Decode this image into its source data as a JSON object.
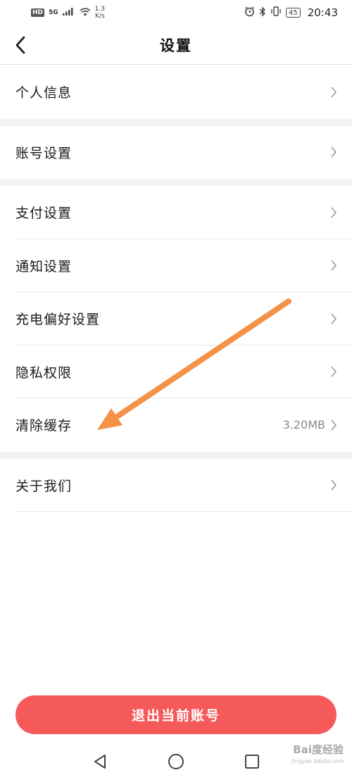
{
  "status_bar": {
    "hd": "HD",
    "signal_tech": "5G",
    "net_speed_value": "1.3",
    "net_speed_unit": "K/s",
    "battery": "45",
    "time": "20:43"
  },
  "header": {
    "title": "设置"
  },
  "settings": [
    {
      "label": "个人信息",
      "value": ""
    },
    {
      "label": "账号设置",
      "value": ""
    },
    {
      "label": "支付设置",
      "value": ""
    },
    {
      "label": "通知设置",
      "value": ""
    },
    {
      "label": "充电偏好设置",
      "value": ""
    },
    {
      "label": "隐私权限",
      "value": ""
    },
    {
      "label": "清除缓存",
      "value": "3.20MB"
    },
    {
      "label": "关于我们",
      "value": ""
    }
  ],
  "logout_label": "退出当前账号",
  "watermark": {
    "brand": "Bai度经验",
    "url": "jingyan.baidu.com"
  },
  "colors": {
    "logout_button": "#f45a5a",
    "annotation_arrow": "#f39248",
    "divider": "#e8e8e8",
    "group_gap": "#f3f3f3"
  },
  "icons": {
    "back": "chevron-left-icon",
    "row_arrow": "chevron-right-icon",
    "sys_back": "triangle-back-icon",
    "sys_home": "circle-home-icon",
    "sys_recent": "square-recent-icon"
  }
}
